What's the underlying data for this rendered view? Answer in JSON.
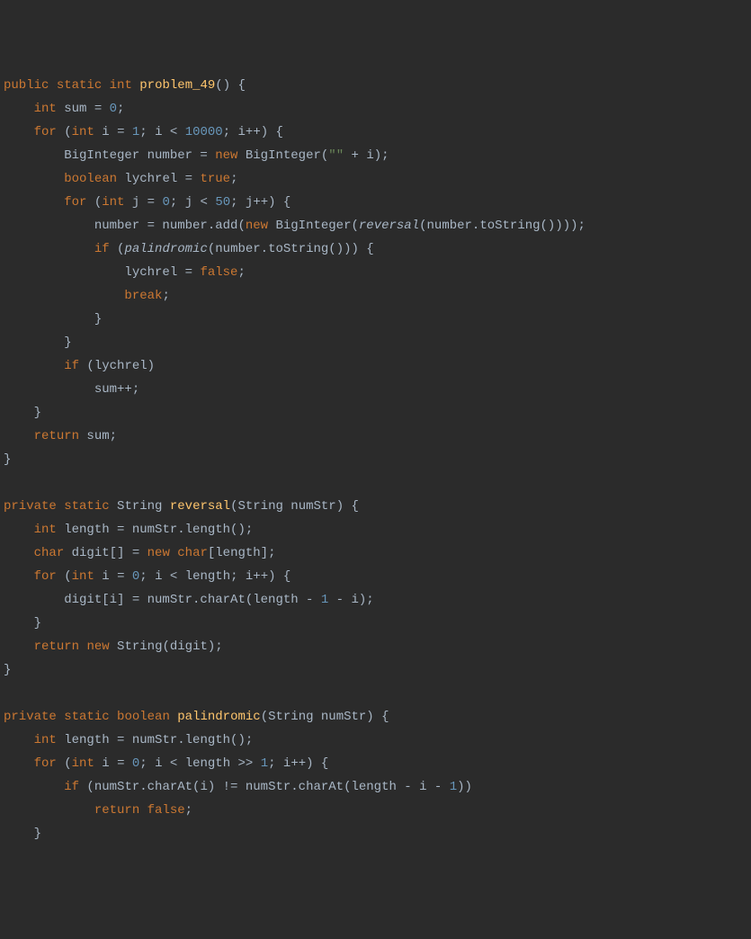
{
  "tokens": [
    [
      [
        "public",
        "k"
      ],
      [
        " ",
        "p"
      ],
      [
        "static",
        "k"
      ],
      [
        " ",
        "p"
      ],
      [
        "int",
        "ty"
      ],
      [
        " ",
        "p"
      ],
      [
        "problem_49",
        "fn"
      ],
      [
        "()",
        "p"
      ],
      [
        " {",
        "p"
      ]
    ],
    [
      [
        "    ",
        "p"
      ],
      [
        "int",
        "ty"
      ],
      [
        " sum = ",
        "p"
      ],
      [
        "0",
        "num"
      ],
      [
        ";",
        "p"
      ]
    ],
    [
      [
        "    ",
        "p"
      ],
      [
        "for",
        "k"
      ],
      [
        " (",
        "p"
      ],
      [
        "int",
        "ty"
      ],
      [
        " i = ",
        "p"
      ],
      [
        "1",
        "num"
      ],
      [
        "; i < ",
        "p"
      ],
      [
        "10000",
        "num"
      ],
      [
        "; i++) {",
        "p"
      ]
    ],
    [
      [
        "        BigInteger number = ",
        "p"
      ],
      [
        "new",
        "k"
      ],
      [
        " BigInteger(",
        "p"
      ],
      [
        "\"\"",
        "str"
      ],
      [
        " + i);",
        "p"
      ]
    ],
    [
      [
        "        ",
        "p"
      ],
      [
        "boolean",
        "ty"
      ],
      [
        " lychrel = ",
        "p"
      ],
      [
        "true",
        "k"
      ],
      [
        ";",
        "p"
      ]
    ],
    [
      [
        "        ",
        "p"
      ],
      [
        "for",
        "k"
      ],
      [
        " (",
        "p"
      ],
      [
        "int",
        "ty"
      ],
      [
        " j = ",
        "p"
      ],
      [
        "0",
        "num"
      ],
      [
        "; j < ",
        "p"
      ],
      [
        "50",
        "num"
      ],
      [
        "; j++) {",
        "p"
      ]
    ],
    [
      [
        "            number = number.add(",
        "p"
      ],
      [
        "new",
        "k"
      ],
      [
        " BigInteger(",
        "p"
      ],
      [
        "reversal",
        "it"
      ],
      [
        "(number.toString())));",
        "p"
      ]
    ],
    [
      [
        "            ",
        "p"
      ],
      [
        "if",
        "k"
      ],
      [
        " (",
        "p"
      ],
      [
        "palindromic",
        "it"
      ],
      [
        "(number.toString())) {",
        "p"
      ]
    ],
    [
      [
        "                lychrel = ",
        "p"
      ],
      [
        "false",
        "k"
      ],
      [
        ";",
        "p"
      ]
    ],
    [
      [
        "                ",
        "p"
      ],
      [
        "break",
        "k"
      ],
      [
        ";",
        "p"
      ]
    ],
    [
      [
        "            }",
        "p"
      ]
    ],
    [
      [
        "        }",
        "p"
      ]
    ],
    [
      [
        "        ",
        "p"
      ],
      [
        "if",
        "k"
      ],
      [
        " (lychrel)",
        "p"
      ]
    ],
    [
      [
        "            sum++;",
        "p"
      ]
    ],
    [
      [
        "    }",
        "p"
      ]
    ],
    [
      [
        "    ",
        "p"
      ],
      [
        "return",
        "k"
      ],
      [
        " sum;",
        "p"
      ]
    ],
    [
      [
        "}",
        "p"
      ]
    ],
    [
      [
        "",
        "p"
      ]
    ],
    [
      [
        "private",
        "k"
      ],
      [
        " ",
        "p"
      ],
      [
        "static",
        "k"
      ],
      [
        " String ",
        "p"
      ],
      [
        "reversal",
        "fn"
      ],
      [
        "(String numStr) {",
        "p"
      ]
    ],
    [
      [
        "    ",
        "p"
      ],
      [
        "int",
        "ty"
      ],
      [
        " length = numStr.length();",
        "p"
      ]
    ],
    [
      [
        "    ",
        "p"
      ],
      [
        "char",
        "ty"
      ],
      [
        " digit[] = ",
        "p"
      ],
      [
        "new",
        "k"
      ],
      [
        " ",
        "p"
      ],
      [
        "char",
        "ty"
      ],
      [
        "[length];",
        "p"
      ]
    ],
    [
      [
        "    ",
        "p"
      ],
      [
        "for",
        "k"
      ],
      [
        " (",
        "p"
      ],
      [
        "int",
        "ty"
      ],
      [
        " i = ",
        "p"
      ],
      [
        "0",
        "num"
      ],
      [
        "; i < length; i++) {",
        "p"
      ]
    ],
    [
      [
        "        digit[i] = numStr.charAt(length - ",
        "p"
      ],
      [
        "1",
        "num"
      ],
      [
        " - i);",
        "p"
      ]
    ],
    [
      [
        "    }",
        "p"
      ]
    ],
    [
      [
        "    ",
        "p"
      ],
      [
        "return",
        "k"
      ],
      [
        " ",
        "p"
      ],
      [
        "new",
        "k"
      ],
      [
        " String(digit);",
        "p"
      ]
    ],
    [
      [
        "}",
        "p"
      ]
    ],
    [
      [
        "",
        "p"
      ]
    ],
    [
      [
        "private",
        "k"
      ],
      [
        " ",
        "p"
      ],
      [
        "static",
        "k"
      ],
      [
        " ",
        "p"
      ],
      [
        "boolean",
        "ty"
      ],
      [
        " ",
        "p"
      ],
      [
        "palindromic",
        "fn"
      ],
      [
        "(String numStr) {",
        "p"
      ]
    ],
    [
      [
        "    ",
        "p"
      ],
      [
        "int",
        "ty"
      ],
      [
        " length = numStr.length();",
        "p"
      ]
    ],
    [
      [
        "    ",
        "p"
      ],
      [
        "for",
        "k"
      ],
      [
        " (",
        "p"
      ],
      [
        "int",
        "ty"
      ],
      [
        " i = ",
        "p"
      ],
      [
        "0",
        "num"
      ],
      [
        "; i < length >> ",
        "p"
      ],
      [
        "1",
        "num"
      ],
      [
        "; i++) {",
        "p"
      ]
    ],
    [
      [
        "        ",
        "p"
      ],
      [
        "if",
        "k"
      ],
      [
        " (numStr.charAt(i) != numStr.charAt(length - i - ",
        "p"
      ],
      [
        "1",
        "num"
      ],
      [
        "))",
        "p"
      ]
    ],
    [
      [
        "            ",
        "p"
      ],
      [
        "return",
        "k"
      ],
      [
        " ",
        "p"
      ],
      [
        "false",
        "k"
      ],
      [
        ";",
        "p"
      ]
    ],
    [
      [
        "    }",
        "p"
      ]
    ]
  ]
}
